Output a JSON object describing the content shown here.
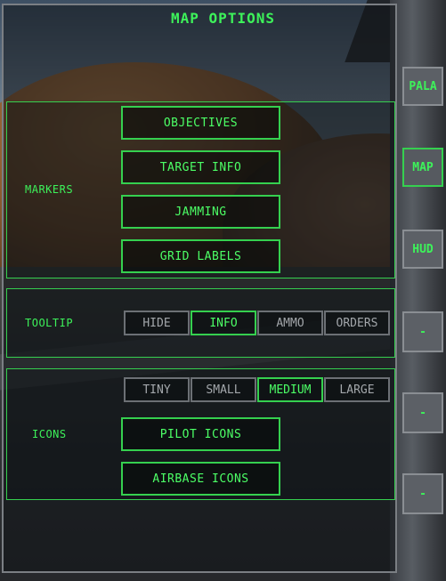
{
  "title": "MAP OPTIONS",
  "markers": {
    "label": "MARKERS",
    "buttons": [
      "OBJECTIVES",
      "TARGET INFO",
      "JAMMING",
      "GRID LABELS"
    ]
  },
  "tooltip": {
    "label": "TOOLTIP",
    "options": [
      "HIDE",
      "INFO",
      "AMMO",
      "ORDERS"
    ],
    "selected": "INFO"
  },
  "icons": {
    "label": "ICONS",
    "sizes": [
      "TINY",
      "SMALL",
      "MEDIUM",
      "LARGE"
    ],
    "selected": "MEDIUM",
    "buttons": [
      "PILOT ICONS",
      "AIRBASE ICONS"
    ]
  },
  "side_tabs": [
    "PALA",
    "MAP",
    "HUD",
    "-",
    "-",
    "-"
  ],
  "active_tab": "MAP",
  "colors": {
    "accent": "#3df25a",
    "inactive": "#6c7075"
  }
}
